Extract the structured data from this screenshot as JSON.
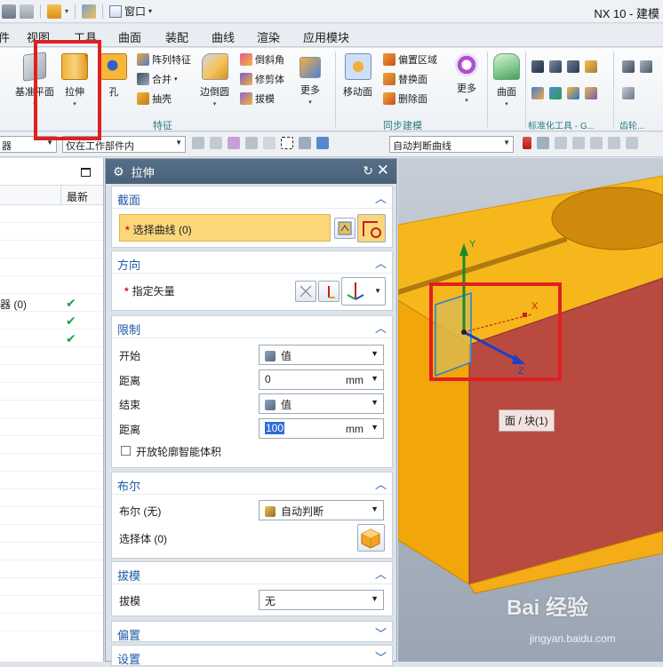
{
  "titlebar": {
    "window_menu": "窗口",
    "app_title": "NX 10 - 建模"
  },
  "menubar": {
    "items": [
      "件",
      "视图",
      "工具",
      "曲面",
      "装配",
      "曲线",
      "渲染",
      "应用模块"
    ]
  },
  "ribbon": {
    "datum_plane": "基准平面",
    "extrude": "拉伸",
    "hole": "孔",
    "pattern_feature": "阵列特征",
    "unite": "合并",
    "shell": "抽壳",
    "edge_blend": "边倒圆",
    "chamfer": "倒斜角",
    "trim_body": "修剪体",
    "draft": "拔模",
    "more1": "更多",
    "move_face": "移动面",
    "offset_region": "偏置区域",
    "replace_face": "替换面",
    "delete_face": "删除面",
    "more2": "更多",
    "surface": "曲面",
    "group_feature": "特征",
    "group_sync": "同步建模",
    "group_std": "标准化工具 - G...",
    "group_gear": "齿轮..."
  },
  "selbar": {
    "filter_left": "器",
    "scope": "仅在工作部件内",
    "curve_rule": "自动判断曲线"
  },
  "navigator": {
    "col_new": "最新",
    "row_label": "器 (0)"
  },
  "dialog": {
    "title": "拉伸",
    "section": {
      "header": "截面",
      "select_curve": "选择曲线 (0)"
    },
    "direction": {
      "header": "方向",
      "specify_vector": "指定矢量"
    },
    "limits": {
      "header": "限制",
      "start_label": "开始",
      "start_value": "值",
      "distance1_label": "距离",
      "distance1_value": "0",
      "unit1": "mm",
      "end_label": "结束",
      "end_value": "值",
      "distance2_label": "距离",
      "distance2_value": "100",
      "unit2": "mm",
      "open_profile": "开放轮廓智能体积"
    },
    "boolean": {
      "header": "布尔",
      "bool_label": "布尔 (无)",
      "bool_value": "自动判断",
      "select_body": "选择体 (0)"
    },
    "draft": {
      "header": "拔模",
      "draft_label": "拔模",
      "draft_value": "无"
    },
    "offset": {
      "header": "偏置"
    },
    "settings": {
      "header": "设置"
    }
  },
  "viewport": {
    "tooltip": "面 / 块(1)",
    "axis_y": "Y",
    "axis_x": "X",
    "axis_z": "Z"
  },
  "watermark": {
    "main": "Bai 经验",
    "sub": "jingyan.baidu.com"
  },
  "colors": {
    "accent": "#1d5aa6",
    "dialog_title": "#4a6279",
    "highlight_red": "#e02020",
    "face_orange": "#f5b400",
    "face_red": "#b84a40"
  }
}
